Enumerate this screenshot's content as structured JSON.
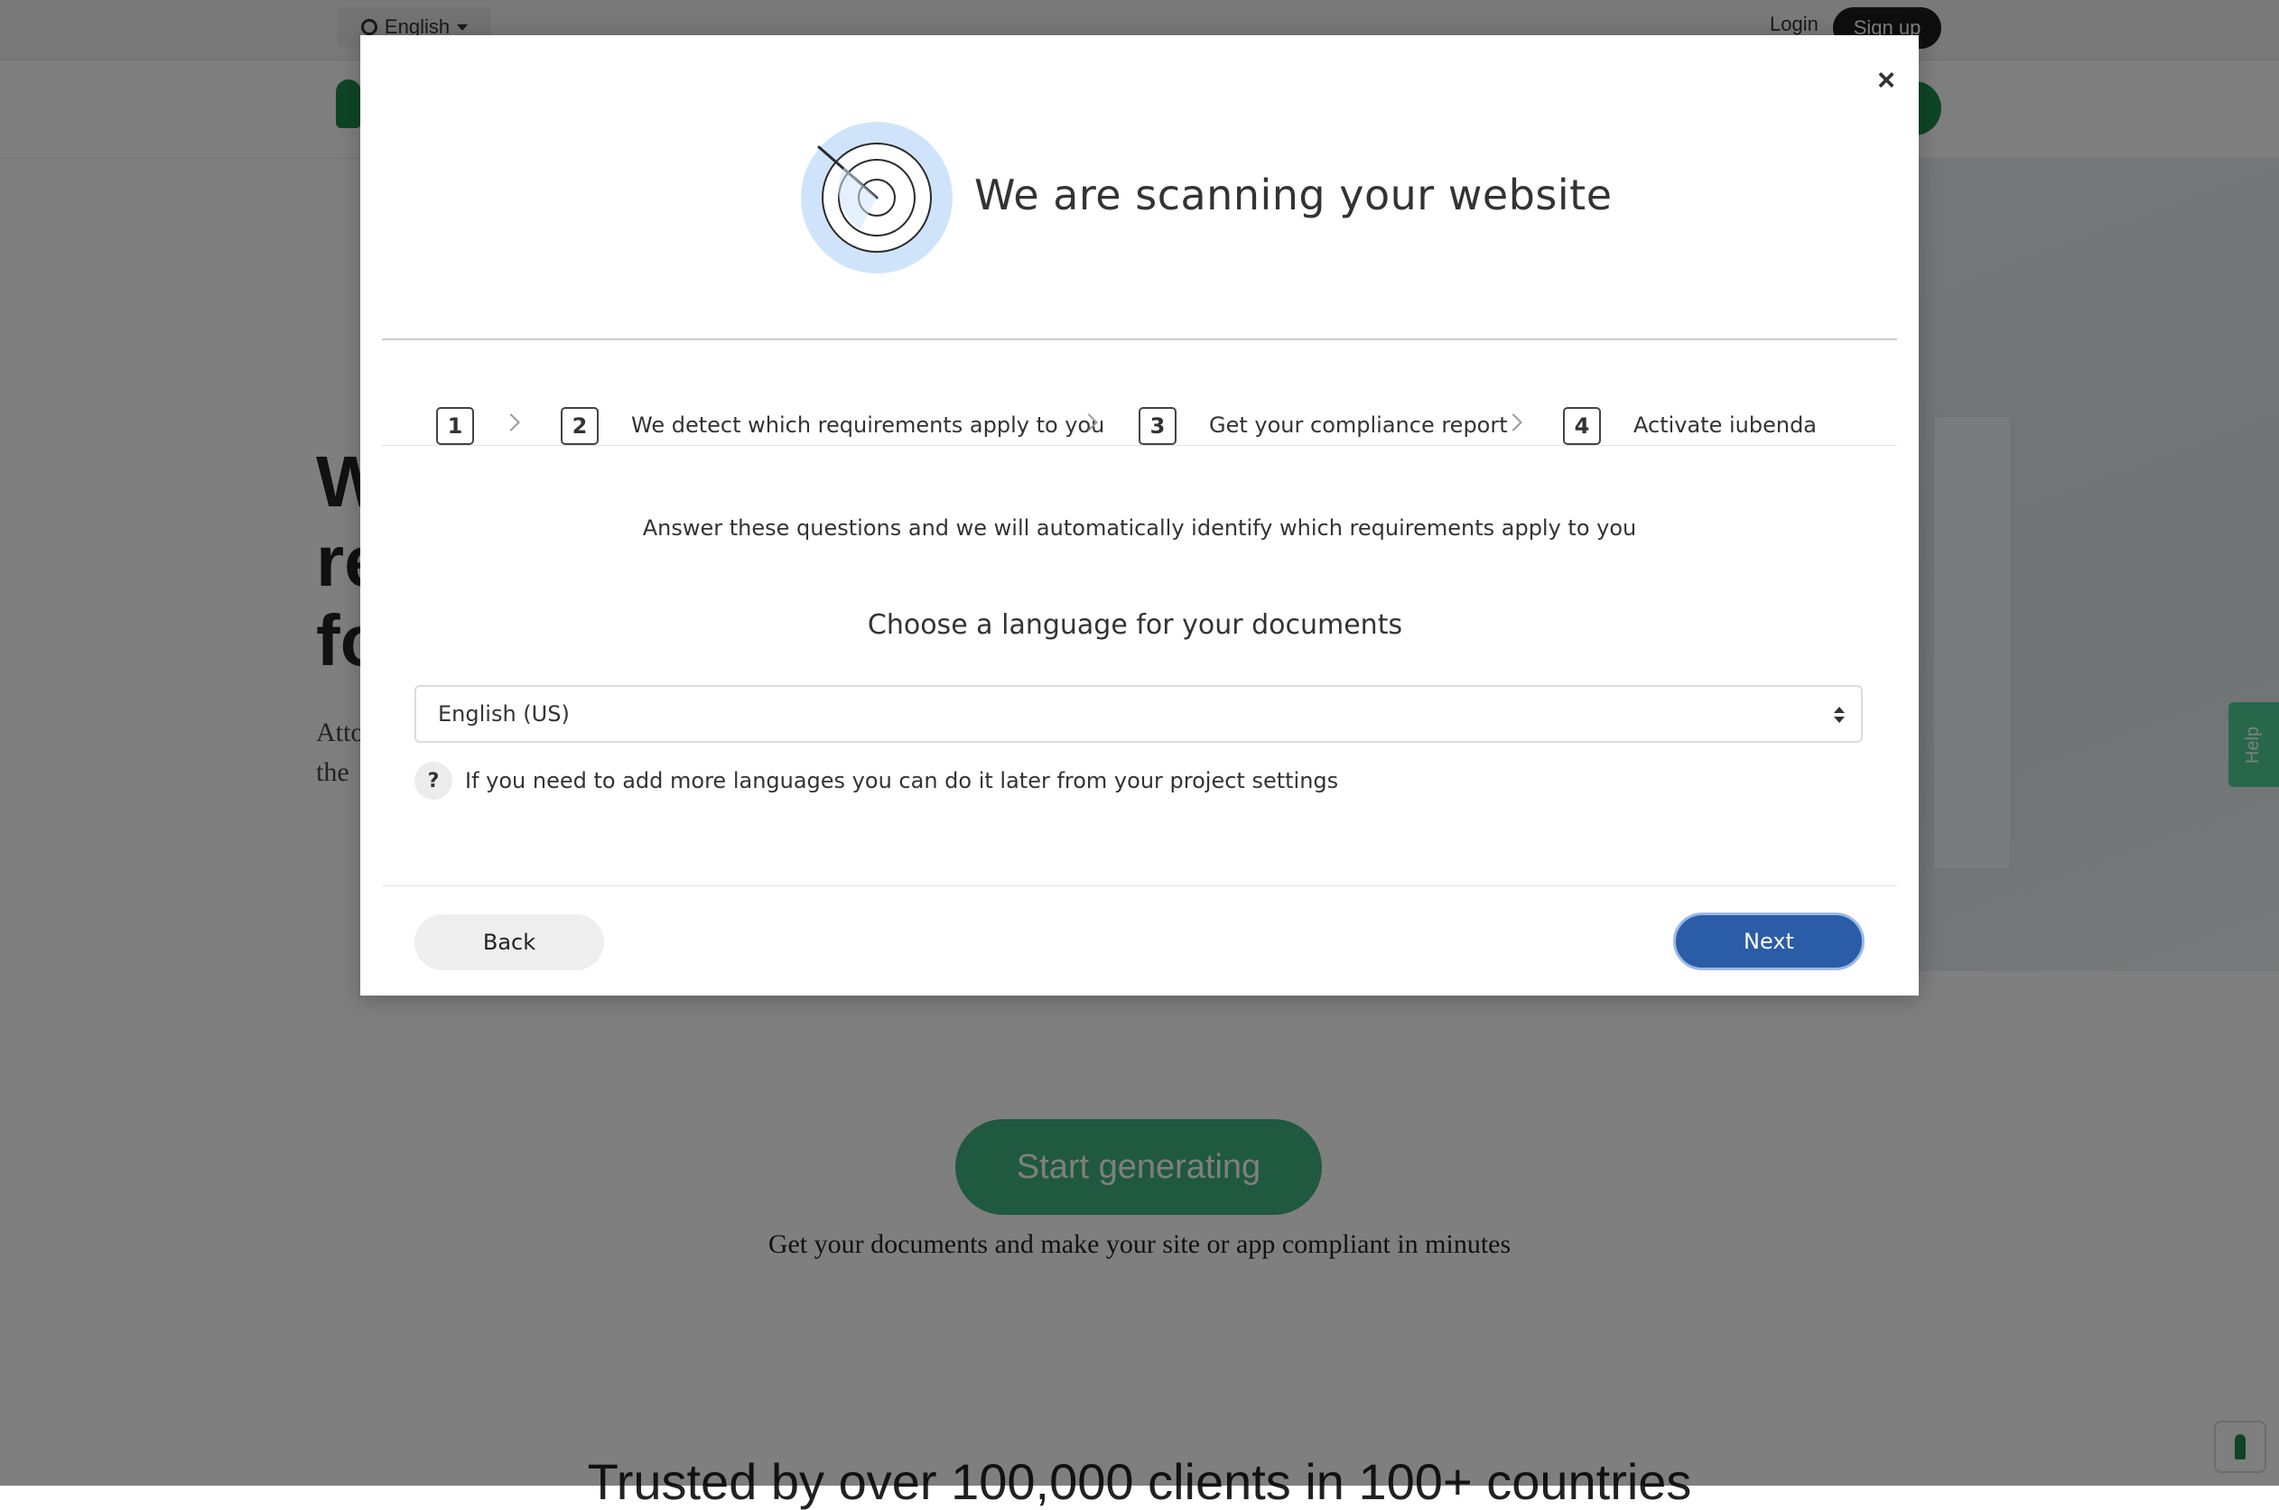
{
  "background": {
    "topbar": {
      "language": "English",
      "login": "Login",
      "signup": "Sign up"
    },
    "hero": {
      "title_fragment": "W re fo",
      "subtitle_fragment": "Atto the"
    },
    "cta": {
      "label": "Start generating",
      "caption": "Get your documents and make your site or app compliant in minutes"
    },
    "trusted": "Trusted by over 100,000 clients in 100+ countries",
    "help_tab": "Help"
  },
  "modal": {
    "title": "We are scanning your website",
    "steps": [
      {
        "number": "1",
        "label": ""
      },
      {
        "number": "2",
        "label": "We detect which requirements apply to you"
      },
      {
        "number": "3",
        "label": "Get your compliance report"
      },
      {
        "number": "4",
        "label": "Activate iubenda"
      }
    ],
    "intro": "Answer these questions and we will automatically identify which requirements apply to you",
    "question": "Choose a language for your documents",
    "language_select": {
      "value": "English (US)"
    },
    "hint": {
      "icon": "?",
      "text": "If you need to add more languages you can do it later from your project settings"
    },
    "buttons": {
      "back": "Back",
      "next": "Next",
      "close": "×"
    }
  },
  "colors": {
    "brand_green": "#1e8b4c",
    "cta_green": "#3fb27f",
    "help_green": "#4fd19a",
    "primary_blue": "#2b5ca8",
    "scan_icon_blue": "#cfe4fb"
  }
}
